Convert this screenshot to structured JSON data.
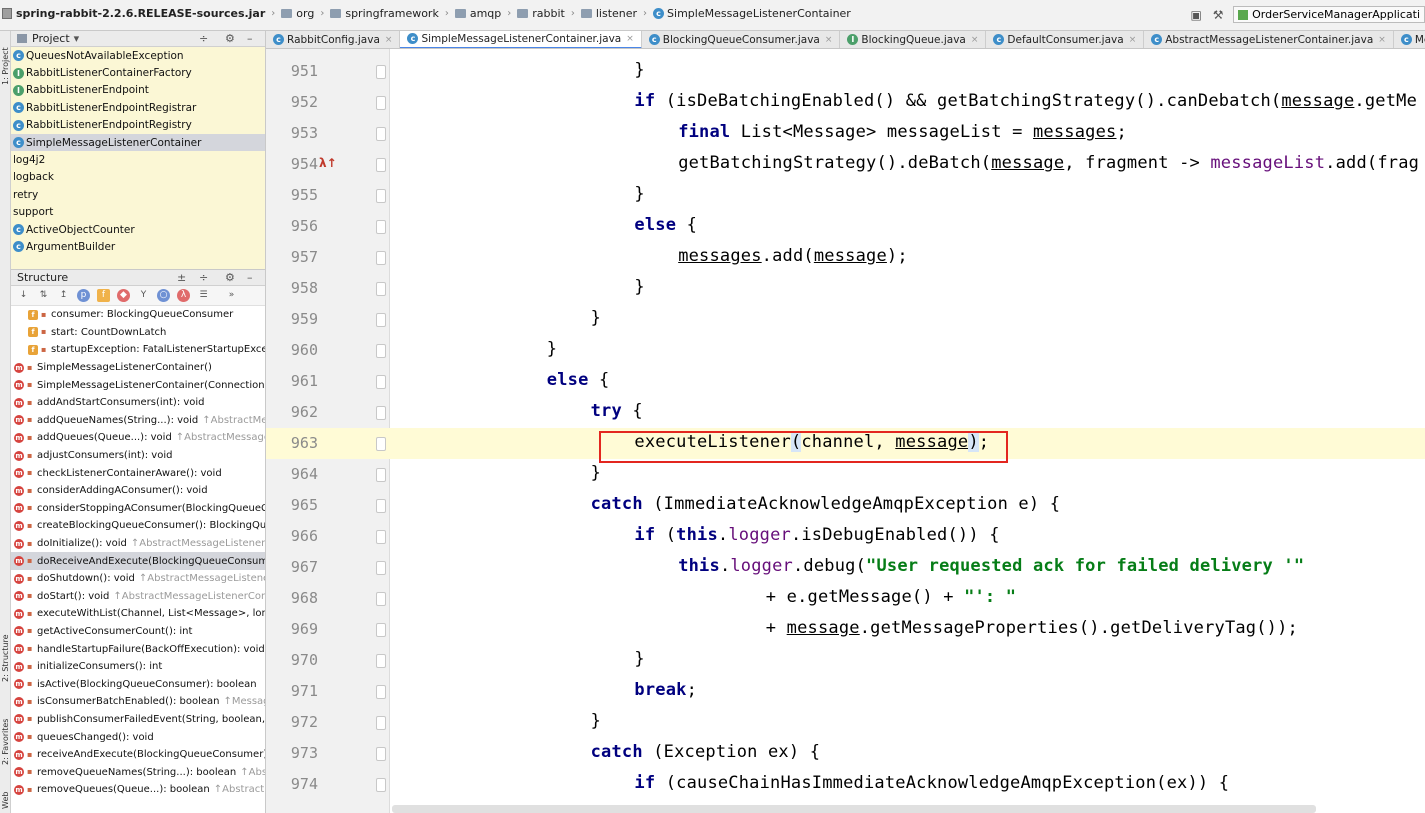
{
  "breadcrumb": {
    "jar": "spring-rabbit-2.2.6.RELEASE-sources.jar",
    "packages": [
      "org",
      "springframework",
      "amqp",
      "rabbit",
      "listener"
    ],
    "class": "SimpleMessageListenerContainer"
  },
  "run_config": "OrderServiceManagerApplicati",
  "left_stripe": {
    "project": "1: Project",
    "structure": "2: Structure",
    "favorites": "2: Favorites",
    "web": "Web"
  },
  "project_panel": {
    "title": "Project",
    "items": [
      {
        "label": "QueuesNotAvailableException",
        "kind": "class"
      },
      {
        "label": "RabbitListenerContainerFactory",
        "kind": "interface"
      },
      {
        "label": "RabbitListenerEndpoint",
        "kind": "interface"
      },
      {
        "label": "RabbitListenerEndpointRegistrar",
        "kind": "class"
      },
      {
        "label": "RabbitListenerEndpointRegistry",
        "kind": "class"
      },
      {
        "label": "SimpleMessageListenerContainer",
        "kind": "class",
        "selected": true
      },
      {
        "label": "log4j2",
        "kind": "folder"
      },
      {
        "label": "logback",
        "kind": "folder"
      },
      {
        "label": "retry",
        "kind": "folder"
      },
      {
        "label": "support",
        "kind": "folder"
      },
      {
        "label": "ActiveObjectCounter",
        "kind": "class"
      },
      {
        "label": "ArgumentBuilder",
        "kind": "class"
      }
    ]
  },
  "structure_panel": {
    "title": "Structure",
    "members": [
      {
        "kind": "field",
        "label": "consumer: BlockingQueueConsumer"
      },
      {
        "kind": "field",
        "label": "start: CountDownLatch"
      },
      {
        "kind": "field",
        "label": "startupException: FatalListenerStartupExcep"
      },
      {
        "kind": "method",
        "label": "SimpleMessageListenerContainer()"
      },
      {
        "kind": "method",
        "label": "SimpleMessageListenerContainer(ConnectionF"
      },
      {
        "kind": "method",
        "label": "addAndStartConsumers(int): void"
      },
      {
        "kind": "method",
        "label": "addQueueNames(String...): void",
        "inherit": "↑AbstractMes"
      },
      {
        "kind": "method",
        "label": "addQueues(Queue...): void",
        "inherit": "↑AbstractMessageL"
      },
      {
        "kind": "method",
        "label": "adjustConsumers(int): void"
      },
      {
        "kind": "method",
        "label": "checkListenerContainerAware(): void"
      },
      {
        "kind": "method",
        "label": "considerAddingAConsumer(): void"
      },
      {
        "kind": "method",
        "label": "considerStoppingAConsumer(BlockingQueueC"
      },
      {
        "kind": "method",
        "label": "createBlockingQueueConsumer(): BlockingQue"
      },
      {
        "kind": "method",
        "label": "doInitialize(): void",
        "inherit": "↑AbstractMessageListenerC"
      },
      {
        "kind": "method",
        "label": "doReceiveAndExecute(BlockingQueueConsum",
        "selected": true
      },
      {
        "kind": "method",
        "label": "doShutdown(): void",
        "inherit": "↑AbstractMessageListener"
      },
      {
        "kind": "method",
        "label": "doStart(): void",
        "inherit": "↑AbstractMessageListenerConta"
      },
      {
        "kind": "method",
        "label": "executeWithList(Channel, List<Message>, long"
      },
      {
        "kind": "method",
        "label": "getActiveConsumerCount(): int"
      },
      {
        "kind": "method",
        "label": "handleStartupFailure(BackOffExecution): void"
      },
      {
        "kind": "method",
        "label": "initializeConsumers(): int"
      },
      {
        "kind": "method",
        "label": "isActive(BlockingQueueConsumer): boolean"
      },
      {
        "kind": "method",
        "label": "isConsumerBatchEnabled(): boolean",
        "inherit": "↑Messag"
      },
      {
        "kind": "method",
        "label": "publishConsumerFailedEvent(String, boolean, "
      },
      {
        "kind": "method",
        "label": "queuesChanged(): void"
      },
      {
        "kind": "method",
        "label": "receiveAndExecute(BlockingQueueConsumer):"
      },
      {
        "kind": "method",
        "label": "removeQueueNames(String...): boolean",
        "inherit": "↑Abst"
      },
      {
        "kind": "method",
        "label": "removeQueues(Queue...): boolean",
        "inherit": "↑AbstractM"
      }
    ]
  },
  "tabs": [
    {
      "label": "RabbitConfig.java"
    },
    {
      "label": "SimpleMessageListenerContainer.java",
      "active": true
    },
    {
      "label": "BlockingQueueConsumer.java"
    },
    {
      "label": "BlockingQueue.java"
    },
    {
      "label": "DefaultConsumer.java"
    },
    {
      "label": "AbstractMessageListenerContainer.java"
    },
    {
      "label": "MessageListenerCo"
    }
  ],
  "editor": {
    "current_line": "963",
    "lines": [
      {
        "n": "951"
      },
      {
        "n": "952"
      },
      {
        "n": "953"
      },
      {
        "n": "954"
      },
      {
        "n": "955"
      },
      {
        "n": "956"
      },
      {
        "n": "957"
      },
      {
        "n": "958"
      },
      {
        "n": "959"
      },
      {
        "n": "960"
      },
      {
        "n": "961"
      },
      {
        "n": "962"
      },
      {
        "n": "963"
      },
      {
        "n": "964"
      },
      {
        "n": "965"
      },
      {
        "n": "966"
      },
      {
        "n": "967"
      },
      {
        "n": "968"
      },
      {
        "n": "969"
      },
      {
        "n": "970"
      },
      {
        "n": "971"
      },
      {
        "n": "972"
      },
      {
        "n": "973"
      },
      {
        "n": "974"
      }
    ]
  }
}
